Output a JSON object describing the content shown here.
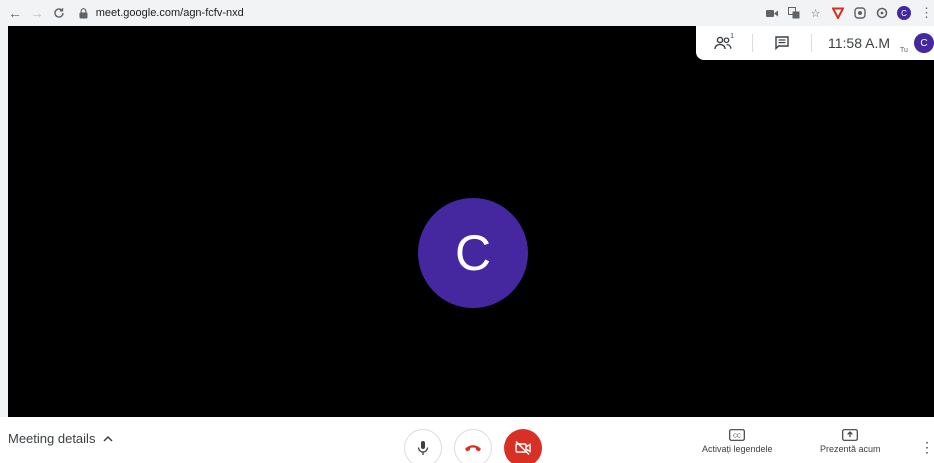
{
  "browser": {
    "url": "meet.google.com/agn-fcfv-nxd",
    "profile_initial": "C",
    "menu_glyph": "⋮"
  },
  "top_panel": {
    "participants_count": "1",
    "clock": "11:58 A.M",
    "self_label": "Tu",
    "profile_initial": "C"
  },
  "stage": {
    "avatar_initial": "C"
  },
  "bottom_bar": {
    "meeting_details_label": "Meeting details",
    "captions_label": "Activați legendele",
    "present_label": "Prezentă acum",
    "more_glyph": "⋮"
  },
  "colors": {
    "avatar": "#4527a0",
    "hangup_icon": "#d93025",
    "camera_off_bg": "#d93025"
  }
}
